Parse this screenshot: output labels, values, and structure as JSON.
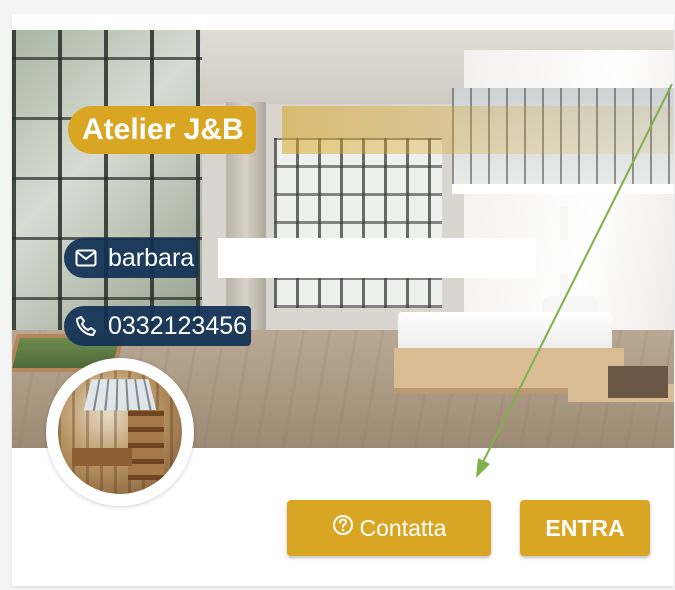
{
  "listing": {
    "title": "Atelier J&B",
    "email": "barbara",
    "phone": "0332123456"
  },
  "actions": {
    "contact_label": "Contatta",
    "enter_label": "ENTRA"
  },
  "icons": {
    "email": "envelope-icon",
    "phone": "phone-icon",
    "contact": "question-circle-icon"
  },
  "colors": {
    "accent": "#d9a624",
    "info_pill": "#103054",
    "annotation_arrow": "#7fb04a"
  }
}
